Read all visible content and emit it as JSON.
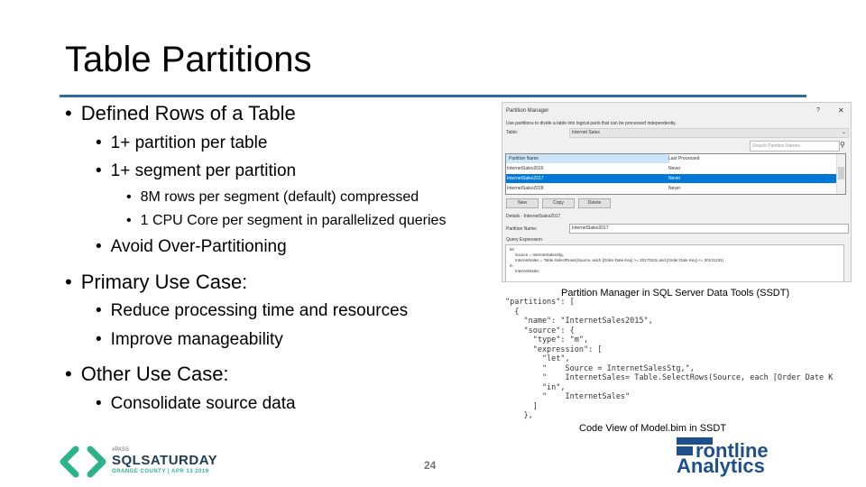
{
  "slide": {
    "title": "Table Partitions",
    "page_number": "24",
    "accent_color": "#2e6a9e"
  },
  "bullets": [
    {
      "level": 1,
      "text": "Defined Rows of a Table"
    },
    {
      "level": 2,
      "text": "1+ partition per table"
    },
    {
      "level": 2,
      "text": "1+ segment per partition"
    },
    {
      "level": 3,
      "text": "8M rows per segment (default) compressed"
    },
    {
      "level": 3,
      "text": "1 CPU Core per segment in parallelized queries"
    },
    {
      "level": 2,
      "text": "Avoid Over-Partitioning"
    },
    {
      "level": 1,
      "text": "Primary Use Case:"
    },
    {
      "level": 2,
      "text": "Reduce processing time and resources"
    },
    {
      "level": 2,
      "text": "Improve manageability"
    },
    {
      "level": 1,
      "text": "Other Use Case:"
    },
    {
      "level": 2,
      "text": "Consolidate source data"
    }
  ],
  "bullet_glyph": "•",
  "partition_manager": {
    "title": "Partition Manager",
    "help_glyph": "?",
    "close_glyph": "✕",
    "description": "Use partitions to divide a table into logical parts that can be processed independently.",
    "table_label": "Table:",
    "table_value": "Internet Sales",
    "search_placeholder": "Search Partition Names",
    "columns": [
      "Partition Name",
      "Last Processed"
    ],
    "rows": [
      {
        "name": "InternetSales2016",
        "last_processed": "Never"
      },
      {
        "name": "InternetSales2017",
        "last_processed": "Never",
        "selected": true
      },
      {
        "name": "InternetSales2018",
        "last_processed": "Never"
      }
    ],
    "buttons": {
      "new": "New",
      "copy": "Copy",
      "delete": "Delete"
    },
    "details_label": "Details - InternetSales2017",
    "partition_name_label": "Partition Name:",
    "partition_name_value": "InternetSales2017",
    "query_expression_label": "Query Expression:",
    "query_expression_lines": [
      "let",
      "    Source = InternetSalesStg,",
      "    InternetSales = Table.SelectRows(Source, each [Order Date Key] >= 20170101 and [Order Date Key] <= 20171231)",
      "in",
      "    InternetSales"
    ]
  },
  "captions": {
    "partition_manager": "Partition Manager in SQL Server Data Tools (SSDT)",
    "code_view": "Code View of Model.bim in SSDT"
  },
  "code_view_lines": [
    "\"partitions\": [",
    "  {",
    "    \"name\": \"InternetSales2015\",",
    "    \"source\": {",
    "      \"type\": \"m\",",
    "      \"expression\": [",
    "        \"let\",",
    "        \"    Source = InternetSalesStg,\",",
    "        \"    InternetSales= Table.SelectRows(Source, each [Order Date K",
    "        \"in\",",
    "        \"    InternetSales\"",
    "      ]",
    "    },"
  ],
  "logos": {
    "sqlsaturday": {
      "pass": "#PASS",
      "name": "SQLSATURDAY",
      "event": "ORANGE COUNTY | APR 13 2019",
      "color": "#2bb38a",
      "text_color": "#1f3c55"
    },
    "frontline": {
      "line1": "rontline",
      "line2": "Analytics",
      "color": "#1d4f8c"
    }
  }
}
